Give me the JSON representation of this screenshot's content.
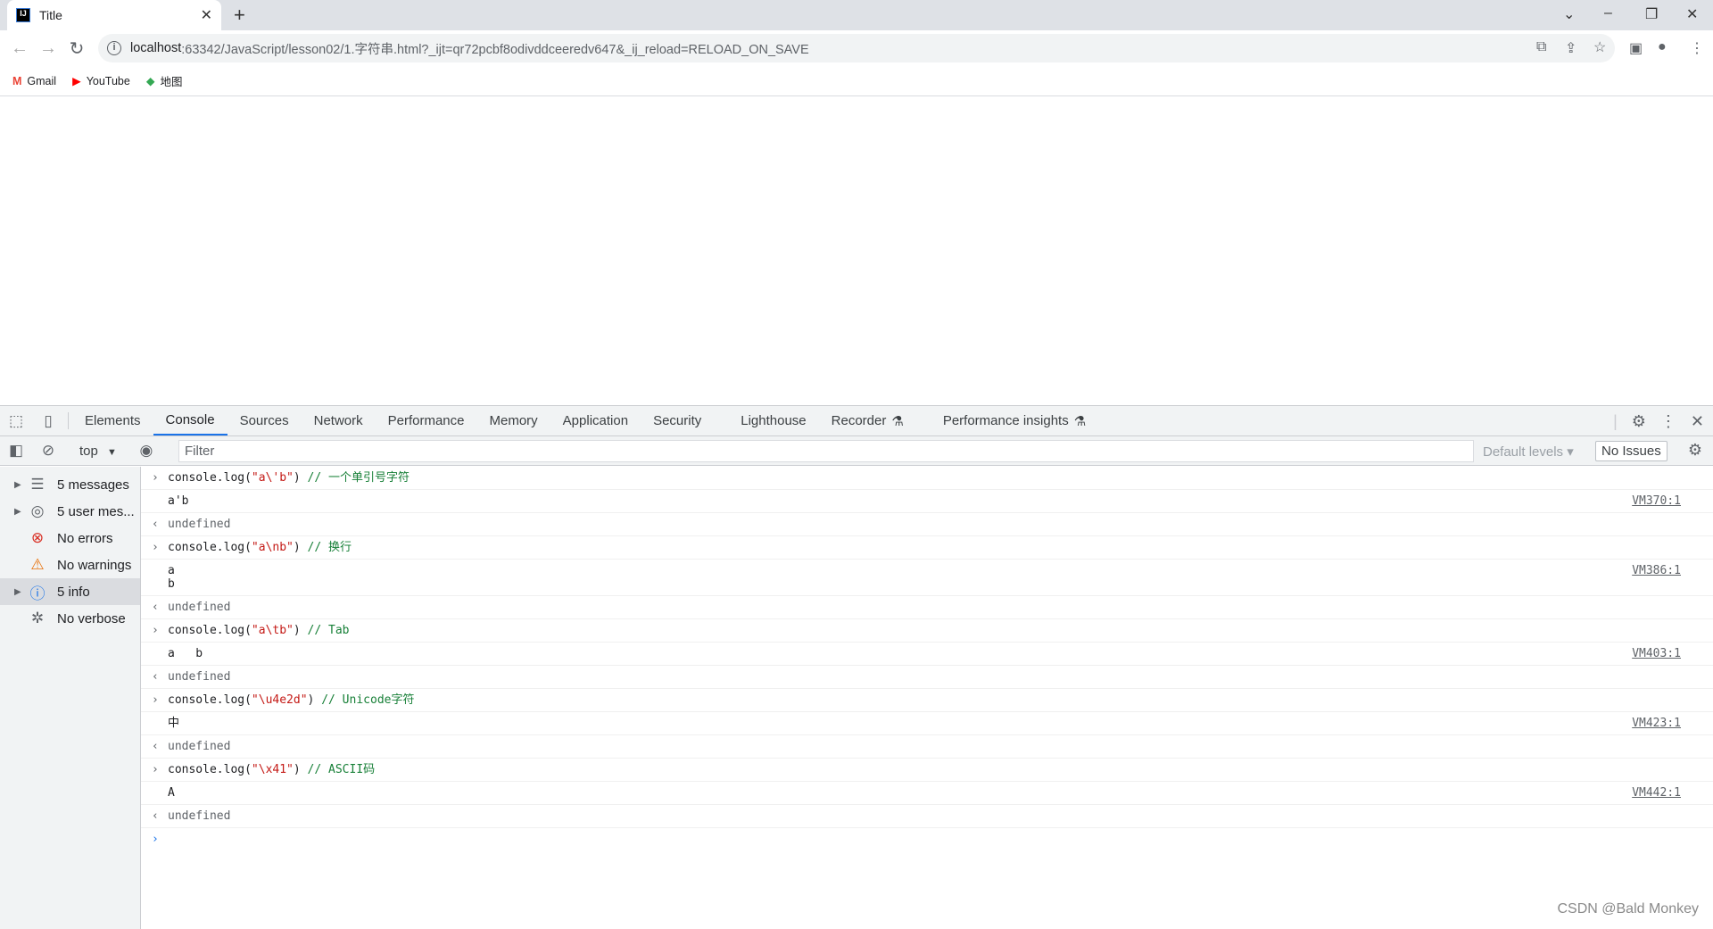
{
  "browser": {
    "tab_title": "Title",
    "favicon_text": "IJ",
    "url_host": "localhost",
    "url_rest": ":63342/JavaScript/lesson02/1.字符串.html?_ijt=qr72pcbf8odivddceeredv647&_ij_reload=RELOAD_ON_SAVE",
    "bookmarks": [
      {
        "label": "Gmail",
        "icon": "gmail-icon",
        "color": "#ea4335"
      },
      {
        "label": "YouTube",
        "icon": "youtube-icon",
        "color": "#ff0000"
      },
      {
        "label": "地图",
        "icon": "maps-icon",
        "color": "#34a853"
      }
    ]
  },
  "devtools": {
    "tabs": [
      "Elements",
      "Console",
      "Sources",
      "Network",
      "Performance",
      "Memory",
      "Application",
      "Security",
      "Lighthouse",
      "Recorder",
      "Performance insights"
    ],
    "active_tab": "Console",
    "context": "top",
    "filter_placeholder": "Filter",
    "levels": "Default levels",
    "issues": "No Issues",
    "sidebar": [
      {
        "label": "5 messages",
        "icon": "list-icon"
      },
      {
        "label": "5 user mes...",
        "icon": "user-icon"
      },
      {
        "label": "No errors",
        "icon": "error-icon"
      },
      {
        "label": "No warnings",
        "icon": "warning-icon"
      },
      {
        "label": "5 info",
        "icon": "info-icon",
        "selected": true
      },
      {
        "label": "No verbose",
        "icon": "bug-icon"
      }
    ],
    "entries": [
      {
        "pre": "console.log(",
        "str": "\"a\\'b\"",
        "post": ") ",
        "comment": "// 一个单引号字符",
        "output": [
          "a'b"
        ],
        "source": "VM370:1"
      },
      {
        "pre": "console.log(",
        "str": "\"a\\nb\"",
        "post": ") ",
        "comment": "// 换行",
        "output": [
          "a",
          "b"
        ],
        "source": "VM386:1"
      },
      {
        "pre": "console.log(",
        "str": "\"a\\tb\"",
        "post": ") ",
        "comment": "// Tab",
        "output": [
          "a   b"
        ],
        "source": "VM403:1"
      },
      {
        "pre": "console.log(",
        "str": "\"\\u4e2d\"",
        "post": ")  ",
        "comment": "// Unicode字符",
        "output": [
          "中"
        ],
        "source": "VM423:1"
      },
      {
        "pre": "console.log(",
        "str": "\"\\x41\"",
        "post": ") ",
        "comment": "// ASCII码",
        "output": [
          "A"
        ],
        "source": "VM442:1"
      }
    ],
    "undefined_label": "undefined"
  },
  "watermark": "CSDN @Bald Monkey"
}
